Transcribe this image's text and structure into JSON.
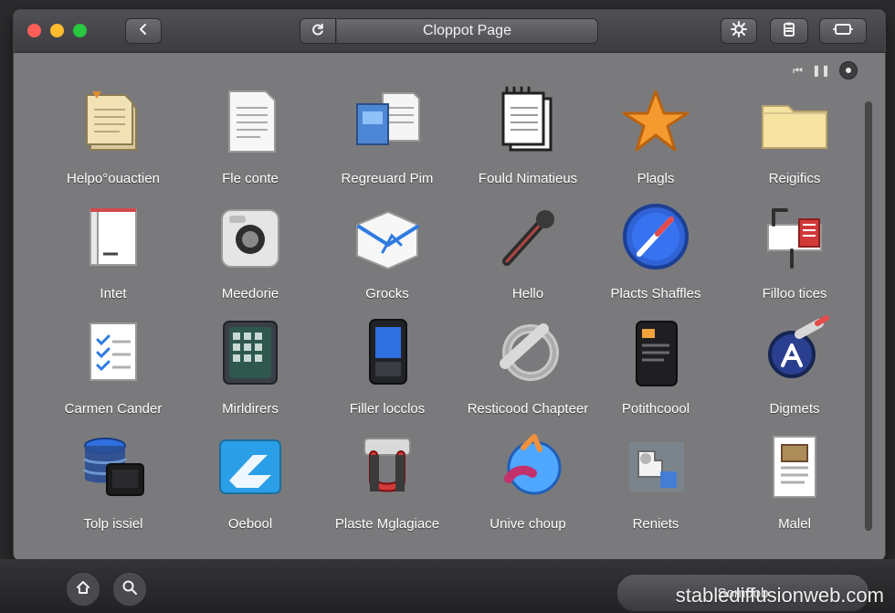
{
  "window": {
    "title": "Cloppot Page"
  },
  "toolbar": {
    "back_icon": "chevron-left-icon",
    "reload_icon": "reload-icon",
    "right_icons": [
      "settings-gear-icon",
      "clipboard-icon",
      "display-icon"
    ]
  },
  "mini_controls": {
    "icons": [
      "backward-skip-icon",
      "pause-icon",
      "dot-icon"
    ]
  },
  "grid": {
    "items": [
      {
        "label": "Helpo°ouactien",
        "icon": "note-stack-icon"
      },
      {
        "label": "Fle conte",
        "icon": "document-icon"
      },
      {
        "label": "Regreuard Pim",
        "icon": "docs-with-image-icon"
      },
      {
        "label": "Fould Nimatieus",
        "icon": "notebook-icon"
      },
      {
        "label": "Plagls",
        "icon": "star-icon"
      },
      {
        "label": "Reigifics",
        "icon": "folder-icon"
      },
      {
        "label": "Intet",
        "icon": "binder-icon"
      },
      {
        "label": "Meedorie",
        "icon": "camera-icon"
      },
      {
        "label": "Grocks",
        "icon": "mail-icon"
      },
      {
        "label": "Hello",
        "icon": "microphone-icon"
      },
      {
        "label": "Placts Shaffles",
        "icon": "compass-icon"
      },
      {
        "label": "Filloo tices",
        "icon": "tools-icon"
      },
      {
        "label": "Carmen Cander",
        "icon": "checklist-icon"
      },
      {
        "label": "Mirldirers",
        "icon": "calculator-icon"
      },
      {
        "label": "Filler locclos",
        "icon": "device-icon"
      },
      {
        "label": "Resticood Chapteer",
        "icon": "ring-icon"
      },
      {
        "label": "Potithcoool",
        "icon": "wallet-icon"
      },
      {
        "label": "Digmets",
        "icon": "pen-nib-icon"
      },
      {
        "label": "Tolp issiel",
        "icon": "database-icon"
      },
      {
        "label": "Oebool",
        "icon": "app-store-icon"
      },
      {
        "label": "Plaste Mglagiace",
        "icon": "magnet-icon"
      },
      {
        "label": "Unive choup",
        "icon": "globe-arrow-icon"
      },
      {
        "label": "Reniets",
        "icon": "puzzle-icon"
      },
      {
        "label": "Malel",
        "icon": "photo-document-icon"
      }
    ]
  },
  "bottom": {
    "left_buttons": [
      "home-icon",
      "search-icon"
    ],
    "search_label": "Somdob"
  },
  "watermark": {
    "text": "stablediffusionweb.com"
  }
}
